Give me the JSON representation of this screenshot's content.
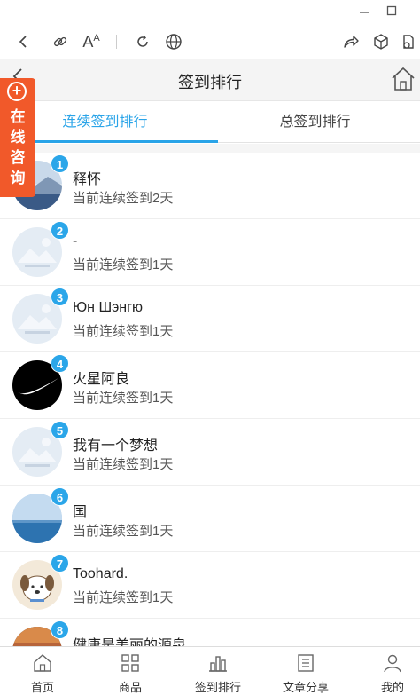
{
  "window": {
    "minimize_icon": "minimize-icon",
    "maximize_icon": "maximize-icon"
  },
  "toolbar": {
    "icons": [
      "back-icon",
      "link-icon",
      "text-size-icon",
      "refresh-icon",
      "globe-icon",
      "share-icon",
      "cube-icon",
      "download-icon"
    ],
    "text_size_label": "A"
  },
  "header": {
    "title": "签到排行"
  },
  "tabs": [
    {
      "label": "连续签到排行",
      "active": true
    },
    {
      "label": "总签到排行",
      "active": false
    }
  ],
  "consult": {
    "plus": "+",
    "label": [
      "在",
      "线",
      "咨",
      "询"
    ]
  },
  "list": [
    {
      "rank": "1",
      "name": "释怀",
      "status": "当前连续签到2天",
      "avatar": "lake"
    },
    {
      "rank": "2",
      "name": "-",
      "status": "当前连续签到1天",
      "avatar": "placeholder"
    },
    {
      "rank": "3",
      "name": "Юн Шэнгю",
      "status": "当前连续签到1天",
      "avatar": "placeholder"
    },
    {
      "rank": "4",
      "name": "火星阿良",
      "status": "当前连续签到1天",
      "avatar": "swoosh"
    },
    {
      "rank": "5",
      "name": "我有一个梦想",
      "status": "当前连续签到1天",
      "avatar": "placeholder"
    },
    {
      "rank": "6",
      "name": "国",
      "status": "当前连续签到1天",
      "avatar": "sea"
    },
    {
      "rank": "7",
      "name": "Toohard.",
      "status": "当前连续签到1天",
      "avatar": "dog"
    },
    {
      "rank": "8",
      "name": "健康是美丽的源泉",
      "status": "",
      "avatar": "sunset"
    }
  ],
  "bottom_nav": [
    {
      "label": "首页",
      "icon": "home-icon"
    },
    {
      "label": "商品",
      "icon": "grid-icon"
    },
    {
      "label": "签到排行",
      "icon": "bar-chart-icon"
    },
    {
      "label": "文章分享",
      "icon": "document-icon"
    },
    {
      "label": "我的",
      "icon": "user-icon"
    }
  ],
  "colors": {
    "accent": "#2aa4e8",
    "consult_bg": "#f1592a",
    "rank_badge": "#2ba6e9"
  }
}
